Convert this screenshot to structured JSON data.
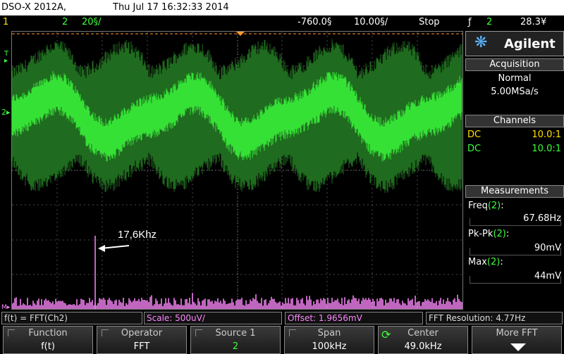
{
  "title_bar": {
    "model": "DSO-X 2012A,",
    "datetime": "Thu Jul 17 16:32:33 2014"
  },
  "status_bar": {
    "ch1_num": "1",
    "ch2_num": "2",
    "ch2_scale": "20§/",
    "time_offset": "-760.0§",
    "time_scale": "10.00§/",
    "run_state": "Stop",
    "trigger_icon": "ƒ",
    "trigger_source": "2",
    "trigger_level": "28.3¥"
  },
  "side_panel": {
    "brand": "Agilent",
    "acquisition": {
      "title": "Acquisition",
      "mode": "Normal",
      "rate": "5.00MSa/s"
    },
    "channels": {
      "title": "Channels",
      "rows": [
        {
          "coupling": "DC",
          "ratio": "10.0:1",
          "color": "#ffe000"
        },
        {
          "coupling": "DC",
          "ratio": "10.0:1",
          "color": "#3cff3c"
        }
      ]
    },
    "measurements": {
      "title": "Measurements",
      "items": [
        {
          "label": "Freq",
          "src": "(2)",
          "tail": ":",
          "value": "67.68Hz"
        },
        {
          "label": "Pk-Pk",
          "src": "(2)",
          "tail": ":",
          "value": "90mV"
        },
        {
          "label": "Max",
          "src": "(2)",
          "tail": ":",
          "value": "44mV"
        }
      ]
    }
  },
  "screen": {
    "annotation": "17,6Khz",
    "markers": {
      "trigger": "T",
      "ch2": "2",
      "math": "M"
    }
  },
  "info_bar": {
    "math_fn": "f(t) = FFT(Ch2)",
    "scale": "Scale: 500uV/",
    "offset": "Offset: 1.9656mV",
    "resolution": "FFT Resolution: 4.77Hz"
  },
  "softkeys": [
    {
      "label": "Function",
      "value": "f(t)"
    },
    {
      "label": "Operator",
      "value": "FFT"
    },
    {
      "label": "Source 1",
      "value": "2"
    },
    {
      "label": "Span",
      "value": "100kHz"
    },
    {
      "label": "Center",
      "value": "49.0kHz"
    },
    {
      "label": "More FFT",
      "value": ""
    }
  ],
  "colors": {
    "ch1": "#ffe000",
    "ch2": "#3cff3c",
    "math": "#ff88ff",
    "accent": "#ff9933"
  }
}
